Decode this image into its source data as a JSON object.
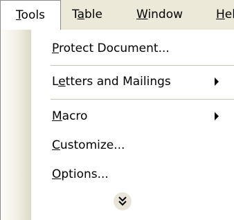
{
  "menubar": {
    "items": [
      {
        "acc": "T",
        "rest": "ools"
      },
      {
        "pre": "T",
        "acc": "a",
        "rest": "ble"
      },
      {
        "acc": "W",
        "rest": "indow"
      },
      {
        "acc": "H",
        "rest": "elp"
      }
    ]
  },
  "dropdown": {
    "items": [
      {
        "acc": "P",
        "rest": "rotect Document..."
      },
      {
        "pre": "L",
        "acc": "e",
        "rest": "tters and Mailings"
      },
      {
        "acc": "M",
        "rest": "acro"
      },
      {
        "acc": "C",
        "rest": "ustomize..."
      },
      {
        "acc": "O",
        "rest": "ptions..."
      }
    ],
    "expand_icon": "double-chevron-down-icon"
  }
}
